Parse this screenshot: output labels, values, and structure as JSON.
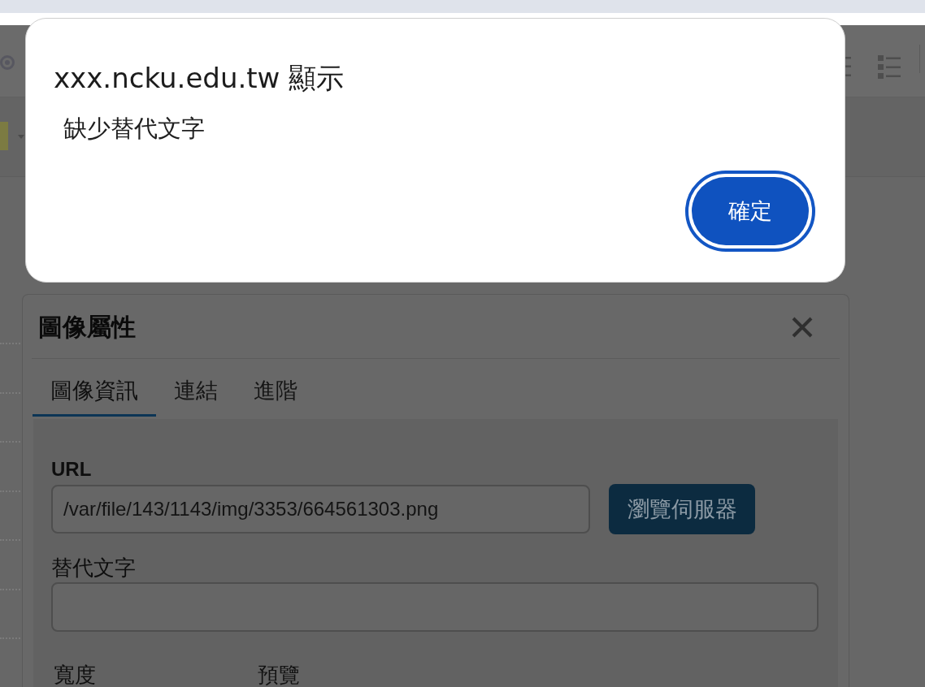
{
  "browser_alert": {
    "title": "xxx.ncku.edu.tw 顯示",
    "message": "缺少替代文字",
    "button": "確定"
  },
  "image_dialog": {
    "title": "圖像屬性",
    "tabs": [
      {
        "label": "圖像資訊",
        "selected": true
      },
      {
        "label": "連結",
        "selected": false
      },
      {
        "label": "進階",
        "selected": false
      }
    ],
    "url_field": {
      "label": "URL",
      "value": "/var/file/143/1143/img/3353/664561303.png"
    },
    "browse_button": "瀏覽伺服器",
    "alt_field": {
      "label": "替代文字"
    },
    "size_label": "寬度",
    "preview_label": "預覽"
  }
}
